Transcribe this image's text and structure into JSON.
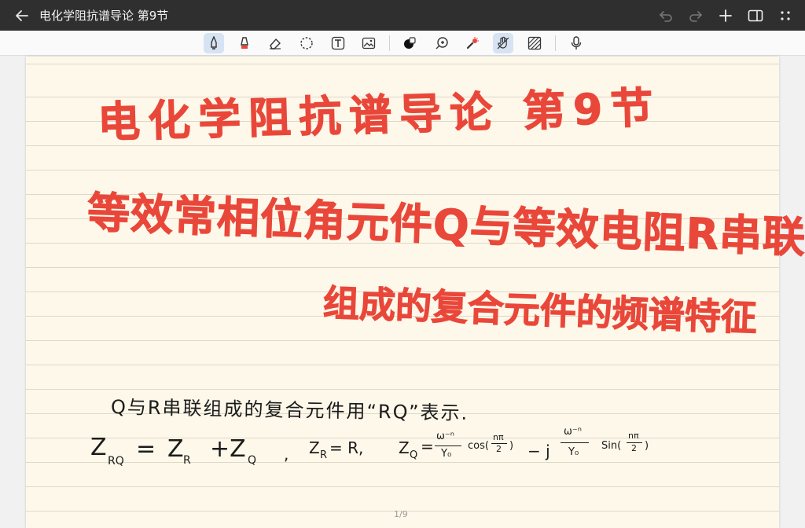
{
  "window": {
    "title": "电化学阻抗谱导论 第9节",
    "icons": [
      "back-arrow-icon",
      "undo-icon",
      "redo-icon",
      "add-icon",
      "sidebar-toggle-icon",
      "more-dots-icon"
    ]
  },
  "toolbar": {
    "tools": [
      "pen-icon",
      "highlighter-icon",
      "eraser-icon",
      "lasso-icon",
      "text-icon",
      "image-icon",
      "color-icon",
      "zoom-icon",
      "laser-pointer-icon",
      "hand-draw-icon",
      "shape-pattern-icon",
      "microphone-icon"
    ],
    "active_tools": [
      "pen-icon",
      "hand-draw-icon"
    ]
  },
  "colors": {
    "accent_ink": "#e9473a",
    "paper": "#fdf8e9",
    "active_tool_bg": "#d6e3f3"
  },
  "note": {
    "title": "电化学阻抗谱导论   第9节",
    "subtitle_line1": "等效常相位角元件Q与等效电阻R串联",
    "subtitle_line2": "组成的复合元件的频谱特征",
    "text_line1": "Q与R串联组成的复合元件用“RQ”表示.",
    "formula": {
      "z": "Z",
      "rq": "RQ",
      "eq1": "=",
      "zr": "Z",
      "r": "R",
      "plus": "+Z",
      "q": "Q",
      "comma1": ",",
      "zr2": "Z",
      "r2": "R",
      "eq2": "= R,",
      "zq": "Z",
      "q2": "Q",
      "eq3": "=",
      "num1": "ω⁻ⁿ",
      "den1": "Y₀",
      "cos": "cos(",
      "cos_num": "nπ",
      "cos_den": "2",
      "close1": ")",
      "minus": "− j",
      "num2": "ω⁻ⁿ",
      "den2": "Y₀",
      "sin": "Sin(",
      "sin_num": "nπ",
      "sin_den": "2",
      "close2": ")"
    },
    "page_indicator": "1/9"
  }
}
